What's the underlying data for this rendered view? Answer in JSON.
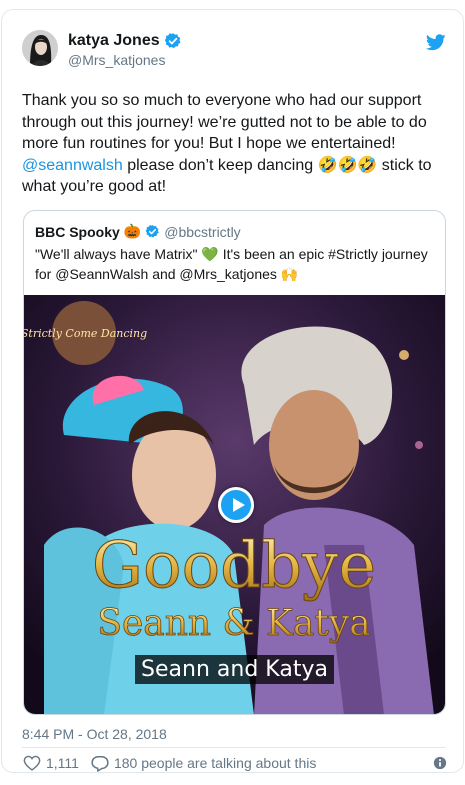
{
  "author": {
    "name": "katya Jones",
    "handle": "@Mrs_katjones"
  },
  "tweet": {
    "part1": "Thank you so so much to everyone who had our support through out this journey! we’re gutted not to be able to do more fun routines for you! But I hope we entertained! ",
    "mention": "@seannwalsh",
    "part2": " please don’t keep dancing ",
    "emoji": "🤣🤣🤣",
    "part3": " stick to what you’re good at!"
  },
  "quoted": {
    "name": "BBC Spooky",
    "name_emoji": "🎃",
    "handle": "@bbcstrictly",
    "text1": "\"We'll always have Matrix\" ",
    "heart_emoji": "💚",
    "text2": " It's been an epic #Strictly journey for @SeannWalsh and @Mrs_katjones ",
    "hands_emoji": "🙌",
    "media": {
      "overlay_title": "Goodbye",
      "overlay_names": "Seann & Katya",
      "caption": "Seann and Katya",
      "logo_text": "Strictly Come Dancing"
    }
  },
  "timestamp": "8:44 PM - Oct 28, 2018",
  "likes": "1,111",
  "talking": "180 people are talking about this",
  "colors": {
    "accent": "#1da1f2",
    "link": "#1b95e0",
    "muted": "#657786"
  }
}
